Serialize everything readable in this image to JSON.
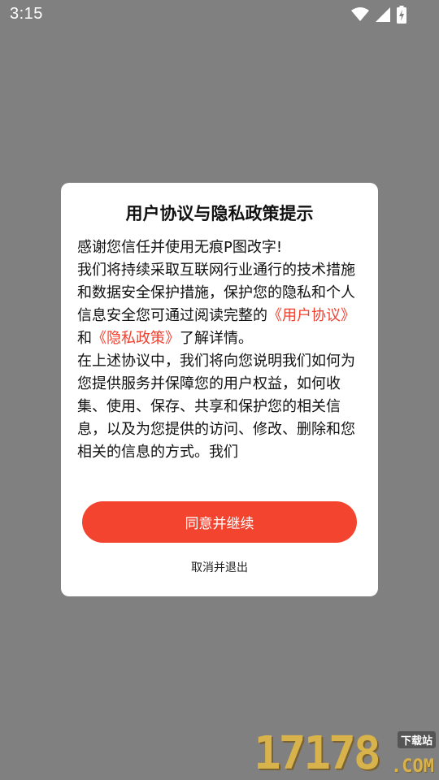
{
  "status_bar": {
    "time": "3:15",
    "icons": [
      "wifi-icon",
      "cellular-signal-icon",
      "battery-charging-icon"
    ],
    "icon_color": "#ffffff"
  },
  "dialog": {
    "title": "用户协议与隐私政策提示",
    "body": {
      "p1": "感谢您信任并使用无痕P图改字!",
      "p2_text": "我们将持续采取互联网行业通行的技术措施和数据安全保护措施，保护您的隐私和个人信息安全您可通过阅读完整的",
      "user_agreement_link": "《用户协议》",
      "and": "和",
      "privacy_policy_link": "《隐私政策》",
      "p2_tail": "了解详情。",
      "p3": "在上述协议中，我们将向您说明我们如何为您提供服务并保障您的用户权益，如何收集、使用、保存、共享和保护您的相关信息，以及为您提供的访问、修改、删除和您相关的信息的方式。我们"
    },
    "agree_button": "同意并继续",
    "cancel_button": "取消并退出",
    "accent_color": "#f2442f"
  },
  "watermark": {
    "digits": "17178",
    "tag": "下载站",
    "domain": ".COM"
  }
}
